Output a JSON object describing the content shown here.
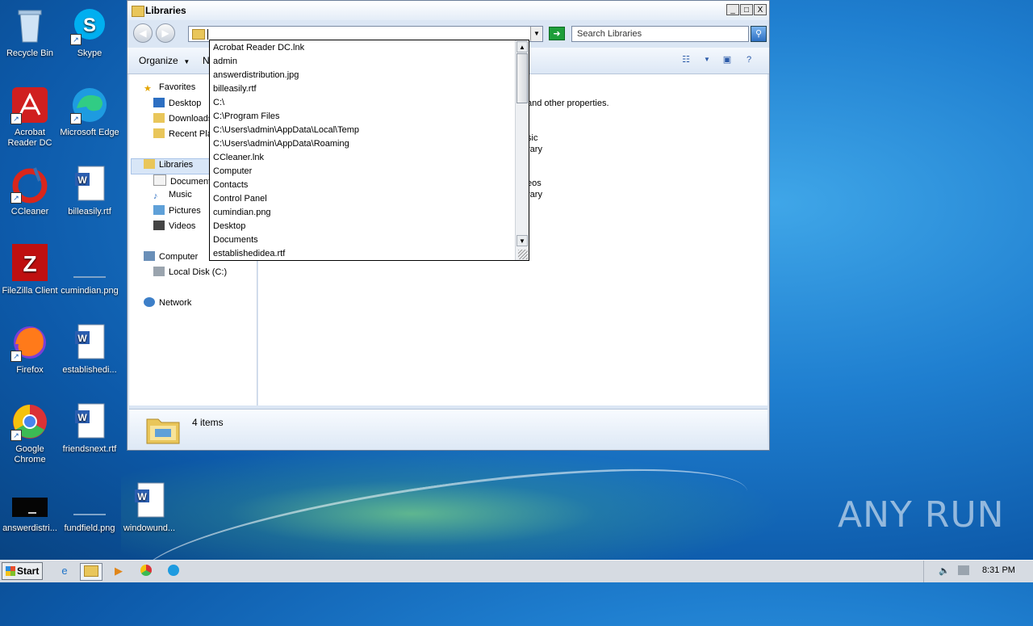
{
  "desktop": {
    "icons": [
      {
        "label": "Recycle Bin"
      },
      {
        "label": "Skype"
      },
      {
        "label": "Acrobat Reader DC"
      },
      {
        "label": "Microsoft Edge"
      },
      {
        "label": "CCleaner"
      },
      {
        "label": "billeasily.rtf"
      },
      {
        "label": "FileZilla Client"
      },
      {
        "label": "cumindian.png"
      },
      {
        "label": "Firefox"
      },
      {
        "label": "establishedi..."
      },
      {
        "label": "Google Chrome"
      },
      {
        "label": "friendsnext.rtf"
      },
      {
        "label": "answerdistri..."
      },
      {
        "label": "fundfield.png"
      },
      {
        "label": "windowund..."
      }
    ],
    "watermark": "ANY RUN"
  },
  "window": {
    "title": "Libraries",
    "controls": {
      "minimize": "_",
      "maximize": "□",
      "close": "X"
    },
    "address": {
      "value": "",
      "dropdown_arrow": "▼"
    },
    "search_placeholder": "Search Libraries",
    "toolbar": {
      "organize": "Organize",
      "organize_caret": "▼",
      "new_partial": "N"
    },
    "nav": {
      "favorites": "Favorites",
      "favorites_items": [
        "Desktop",
        "Downloads",
        "Recent Places"
      ],
      "libraries": "Libraries",
      "libraries_items": [
        "Documents",
        "Music",
        "Pictures",
        "Videos"
      ],
      "computer": "Computer",
      "computer_items": [
        "Local Disk (C:)"
      ],
      "network": "Network"
    },
    "content_fragments": {
      "line1": "and other properties.",
      "music_a": "sic",
      "music_b": "rary",
      "videos_a": "eos",
      "videos_b": "rary"
    },
    "details": {
      "count": "4 items"
    }
  },
  "autocomplete": {
    "items": [
      "Acrobat Reader DC.lnk",
      "admin",
      "answerdistribution.jpg",
      "billeasily.rtf",
      "C:\\",
      "C:\\Program Files",
      "C:\\Users\\admin\\AppData\\Local\\Temp",
      "C:\\Users\\admin\\AppData\\Roaming",
      "CCleaner.lnk",
      "Computer",
      "Contacts",
      "Control Panel",
      "cumindian.png",
      "Desktop",
      "Documents",
      "establishedidea.rtf"
    ]
  },
  "taskbar": {
    "start": "Start",
    "clock": "8:31 PM"
  }
}
